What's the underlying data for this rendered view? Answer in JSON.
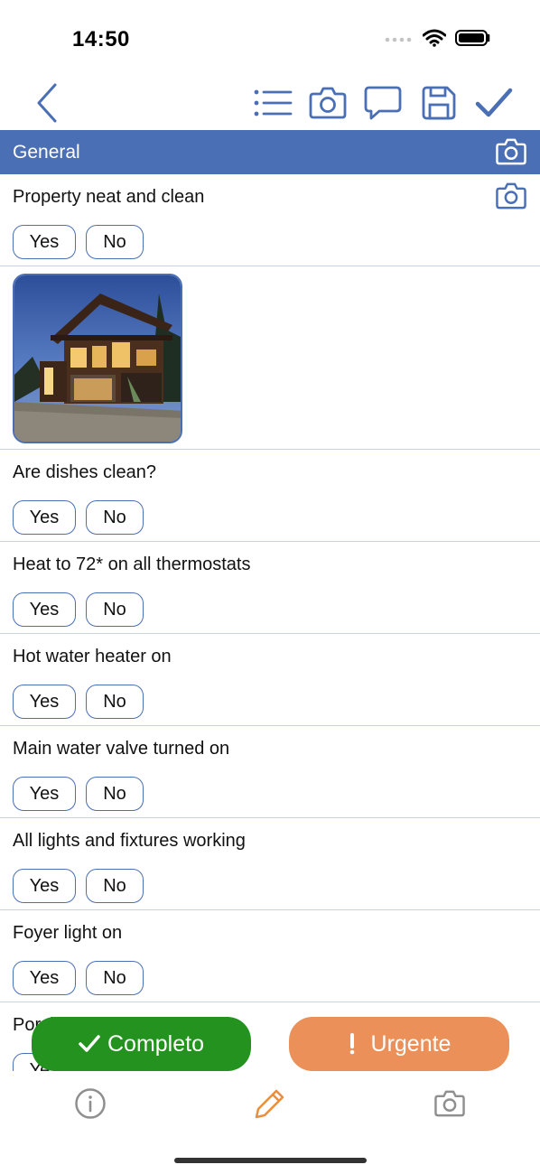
{
  "status": {
    "time": "14:50"
  },
  "nav": {
    "back_icon": "chevron-left-icon",
    "actions": [
      "list-icon",
      "camera-icon",
      "comment-icon",
      "save-icon",
      "checkmark-icon"
    ]
  },
  "section": {
    "title": "General"
  },
  "buttons": {
    "yes": "Yes",
    "no": "No"
  },
  "items": [
    {
      "label": "Property neat and clean"
    },
    {
      "label": "Are dishes clean?"
    },
    {
      "label": "Heat to 72* on all thermostats"
    },
    {
      "label": "Hot water heater on"
    },
    {
      "label": "Main water valve turned on"
    },
    {
      "label": "All lights and fixtures working"
    },
    {
      "label": "Foyer light on"
    },
    {
      "label": "Porch lights on and Sol"
    }
  ],
  "actions": {
    "completo": "Completo",
    "urgente": "Urgente"
  },
  "tabs": [
    "info-icon",
    "pencil-icon",
    "camera-icon"
  ],
  "colors": {
    "accent": "#4a6fb5",
    "completo": "#23921f",
    "urgente": "#eb9058",
    "active_tab": "#ec8f3a"
  }
}
